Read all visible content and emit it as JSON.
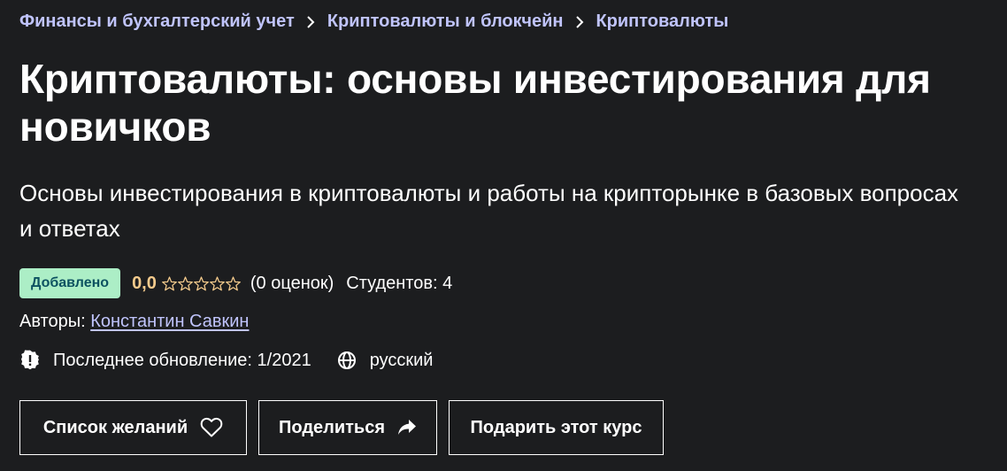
{
  "breadcrumb": [
    {
      "label": "Финансы и бухгалтерский учет"
    },
    {
      "label": "Криптовалюты и блокчейн"
    },
    {
      "label": "Криптовалюты"
    }
  ],
  "course": {
    "title": "Криптовалюты: основы инвестирования для новичков",
    "subtitle": "Основы инвестирования в криптовалюты и работы на крипторынке в базовых вопросах и ответах"
  },
  "meta": {
    "badge": "Добавлено",
    "rating_value": "0,0",
    "rating_stars": 0,
    "rating_max": 5,
    "rating_count": "(0 оценок)",
    "students": "Студентов: 4"
  },
  "authors": {
    "label": "Авторы:",
    "name": "Константин Савкин"
  },
  "info": {
    "last_update": "Последнее обновление: 1/2021",
    "language": "русский"
  },
  "actions": {
    "wishlist": "Список желаний",
    "share": "Поделиться",
    "gift": "Подарить этот курс"
  },
  "colors": {
    "background": "#1c1d1f",
    "link": "#c0c4fc",
    "badge_bg": "#aceec6",
    "badge_text": "#0d5261",
    "rating": "#f3ca8c"
  },
  "icons": {
    "breadcrumb_separator": "chevron-right-icon",
    "update": "alert-badge-icon",
    "language": "globe-icon",
    "wishlist": "heart-outline-icon",
    "share": "share-arrow-icon"
  }
}
